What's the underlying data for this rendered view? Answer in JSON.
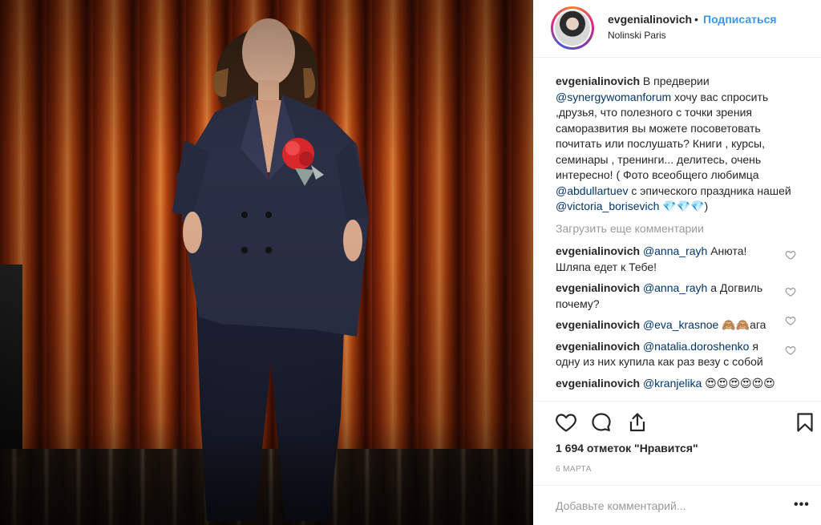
{
  "post": {
    "username": "evgenialinovich",
    "follow_label": "Подписаться",
    "separator": "•",
    "location": "Nolinski Paris",
    "caption": {
      "author": "evgenialinovich",
      "part1": " В предверии ",
      "mention1": "@synergywomanforum",
      "part2": " хочу вас спросить ,друзья, что полезного с точки зрения саморазвития вы можете посоветовать почитать или послушать? Книги , курсы, семинары , тренинги... делитесь, очень интересно! ( Фото всеобщего любимца ",
      "mention2": "@abdullartuev",
      "part3": " с эпического праздника нашей ",
      "mention3": "@victoria_borisevich",
      "part4": " 💎💎💎)"
    },
    "load_more": "Загрузить еще комментарии",
    "comments": [
      {
        "author": "evgenialinovich",
        "mention": "@anna_rayh",
        "text": " Анюта! Шляпа едет к Тебе!"
      },
      {
        "author": "evgenialinovich",
        "mention": "@anna_rayh",
        "text": " а Догвиль почему?"
      },
      {
        "author": "evgenialinovich",
        "mention": "@eva_krasnoe",
        "text": " 🙈🙈ага"
      },
      {
        "author": "evgenialinovich",
        "mention": "@natalia.doroshenko",
        "text": " я одну из них купила как раз везу с собой"
      },
      {
        "author": "evgenialinovich",
        "mention": "@kranjelika",
        "text": " 😍😍😍😍😍😍"
      }
    ],
    "likes": "1 694 отметок \"Нравится\"",
    "date": "6 МАРТА",
    "add_comment_placeholder": "Добавьте комментарий...",
    "more_label": "•••"
  },
  "icons": {
    "like": "heart-icon",
    "comment": "comment-bubble-icon",
    "share": "share-icon",
    "save": "bookmark-icon",
    "comment_like": "heart-icon"
  },
  "colors": {
    "link": "#003569",
    "follow": "#3897f0",
    "muted": "#999999",
    "text": "#262626"
  }
}
